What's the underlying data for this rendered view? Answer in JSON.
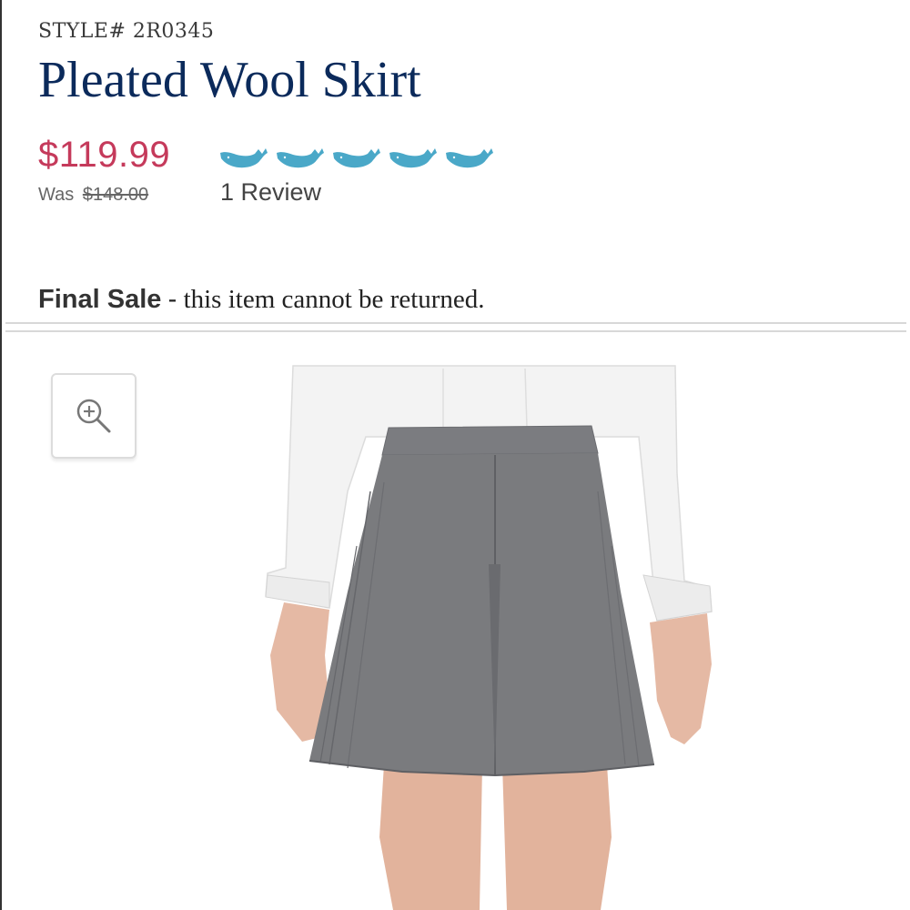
{
  "product": {
    "style_number": "STYLE# 2R0345",
    "title": "Pleated Wool Skirt",
    "price": "$119.99",
    "was_label": "Was",
    "was_price": "$148.00",
    "rating": 5,
    "rating_max": 5,
    "rating_icon": "whale-icon",
    "review_count": "1 Review"
  },
  "notice": {
    "label": "Final Sale",
    "separator": "-",
    "message": "this item cannot be returned."
  },
  "image": {
    "zoom_icon": "zoom-in-icon"
  },
  "colors": {
    "title": "#0b2a5b",
    "price": "#c53a5b",
    "rating": "#4aa8c8",
    "skirt": "#7a7b7e",
    "shirt": "#f4f4f4"
  }
}
